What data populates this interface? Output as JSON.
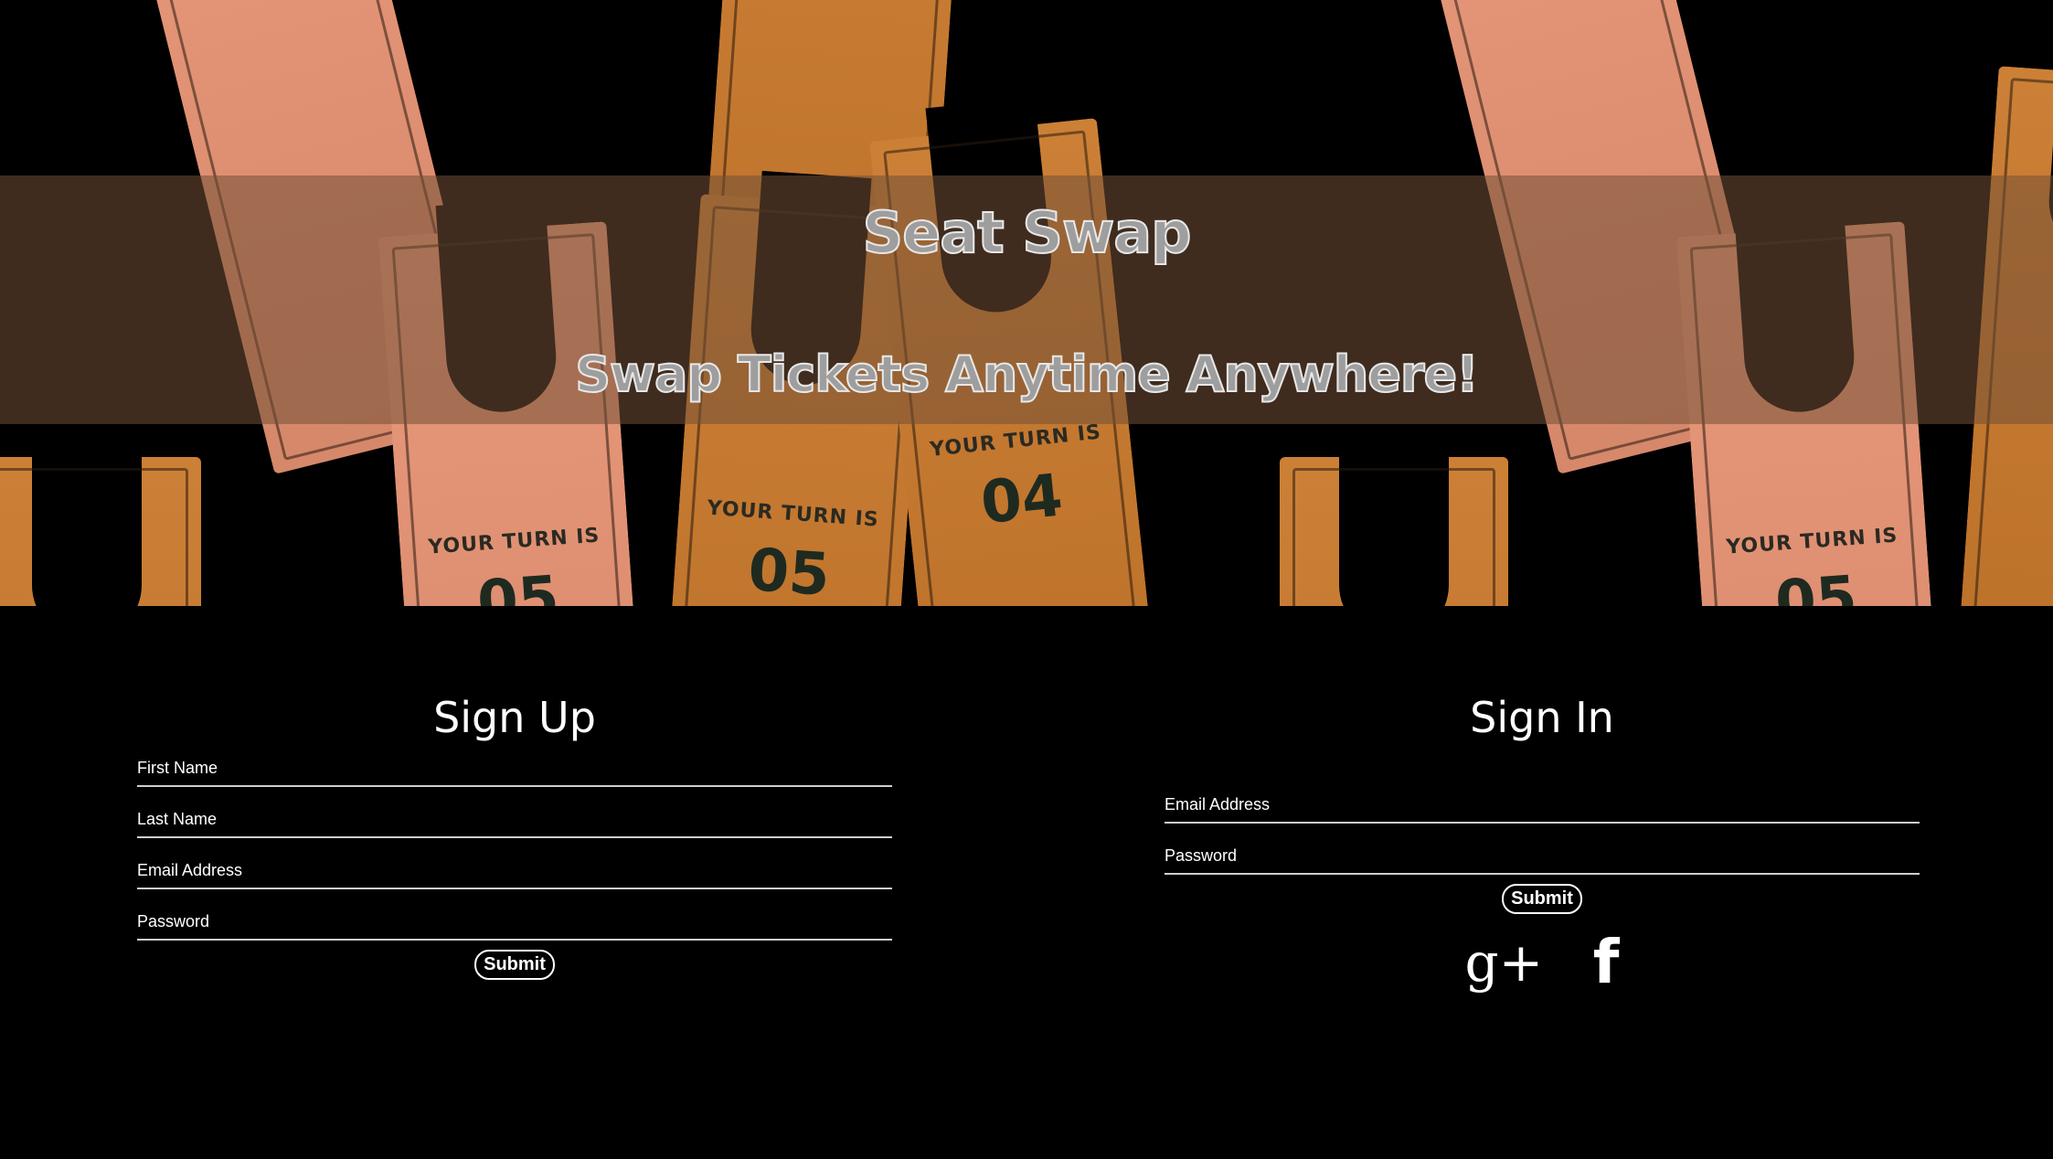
{
  "hero": {
    "title": "Seat Swap",
    "subtitle": "Swap Tickets Anytime Anywhere!",
    "tickets": [
      {
        "label": "YOUR TURN IS",
        "number": "05"
      },
      {
        "label": "YOUR TURN IS",
        "number": "05"
      },
      {
        "label": "YOUR TURN IS",
        "number": "04"
      },
      {
        "label": "YOUR TURN IS",
        "number": "05"
      }
    ]
  },
  "signup": {
    "heading": "Sign Up",
    "first_name_placeholder": "First Name",
    "last_name_placeholder": "Last Name",
    "email_placeholder": "Email Address",
    "password_placeholder": "Password",
    "submit_label": "Submit"
  },
  "signin": {
    "heading": "Sign In",
    "email_placeholder": "Email Address",
    "password_placeholder": "Password",
    "submit_label": "Submit"
  },
  "social": {
    "google_icon": "g+",
    "facebook_icon": "f"
  },
  "colors": {
    "background": "#000000",
    "ticket_pink": "#e89373",
    "ticket_amber": "#c9782a"
  }
}
